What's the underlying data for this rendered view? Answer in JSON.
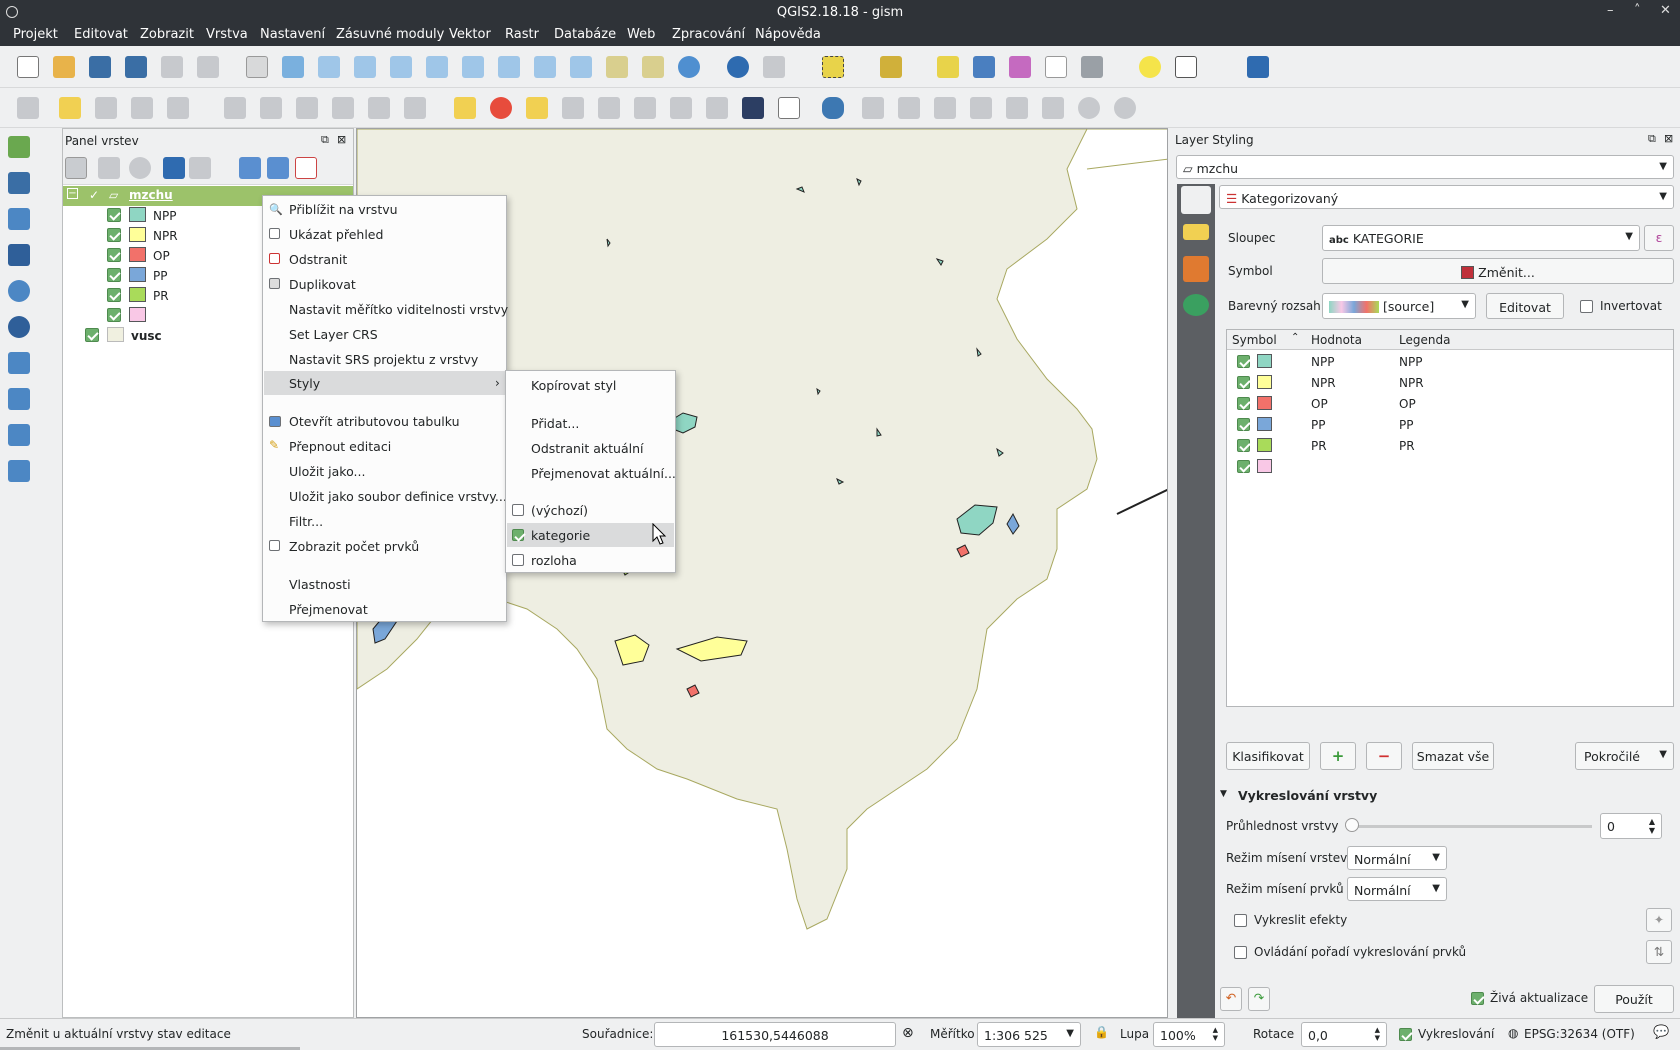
{
  "window": {
    "title": "QGIS2.18.18 - gism"
  },
  "menubar": [
    "Projekt",
    "Editovat",
    "Zobrazit",
    "Vrstva",
    "Nastavení",
    "Zásuvné moduly",
    "Vektor",
    "Rastr",
    "Databáze",
    "Web",
    "Zpracování",
    "Nápověda"
  ],
  "layers_panel": {
    "title": "Panel vrstev",
    "layer_main": "mzchu",
    "categories": [
      {
        "label": "NPP",
        "color": "#8fd6c3"
      },
      {
        "label": "NPR",
        "color": "#ffff99"
      },
      {
        "label": "OP",
        "color": "#f2716a"
      },
      {
        "label": "PP",
        "color": "#7aa7d9"
      },
      {
        "label": "PR",
        "color": "#a9db5a"
      },
      {
        "label": "",
        "color": "#f9c8e6"
      }
    ],
    "layer_second": "vusc"
  },
  "context_menu": {
    "items": [
      "Přiblížit na vrstvu",
      "Ukázat přehled",
      "Odstranit",
      "Duplikovat",
      "Nastavit měřítko viditelnosti vrstvy",
      "Set Layer CRS",
      "Nastavit SRS projektu z vrstvy",
      "Styly",
      "Otevřít atributovou tabulku",
      "Přepnout editaci",
      "Uložit jako...",
      "Uložit jako soubor definice vrstvy...",
      "Filtr...",
      "Zobrazit počet prvků",
      "Vlastnosti",
      "Přejmenovat"
    ]
  },
  "styles_submenu": {
    "items": [
      "Kopírovat styl",
      "Přidat...",
      "Odstranit aktuální",
      "Přejmenovat aktuální...",
      "(výchozí)",
      "kategorie",
      "rozloha"
    ],
    "checked": "kategorie"
  },
  "styling": {
    "title": "Layer Styling",
    "layer": "mzchu",
    "renderer": "Kategorizovaný",
    "column_label": "Sloupec",
    "column_type": "abc",
    "column": "KATEGORIE",
    "symbol_label": "Symbol",
    "symbol_btn": "Změnit...",
    "ramp_label": "Barevný rozsah",
    "ramp": "[source]",
    "edit_btn": "Editovat",
    "invert": "Invertovat",
    "table_headers": [
      "Symbol",
      "Hodnota",
      "Legenda"
    ],
    "rows": [
      {
        "value": "NPP",
        "legend": "NPP",
        "color": "#8fd6c3"
      },
      {
        "value": "NPR",
        "legend": "NPR",
        "color": "#ffff99"
      },
      {
        "value": "OP",
        "legend": "OP",
        "color": "#f2716a"
      },
      {
        "value": "PP",
        "legend": "PP",
        "color": "#7aa7d9"
      },
      {
        "value": "PR",
        "legend": "PR",
        "color": "#a9db5a"
      },
      {
        "value": "",
        "legend": "",
        "color": "#f9c8e6"
      }
    ],
    "classify_btn": "Klasifikovat",
    "delete_all_btn": "Smazat vše",
    "advanced_btn": "Pokročilé",
    "render_section": "Vykreslování vrstvy",
    "opacity_label": "Průhlednost vrstvy",
    "opacity": "0",
    "blend_layer_label": "Režim mísení vrstev",
    "blend_layer": "Normální",
    "blend_feature_label": "Režim mísení prvků",
    "blend_feature": "Normální",
    "effects_label": "Vykreslit efekty",
    "order_label": "Ovládání pořadí vykreslování prvků",
    "live_update": "Živá aktualizace",
    "apply_btn": "Použít"
  },
  "status": {
    "message": "Změnit u aktuální vrstvy stav editace",
    "coord_label": "Souřadnice:",
    "coord": "161530,5446088",
    "scale_label": "Měřítko",
    "scale": "1:306 525",
    "zoom_label": "Lupa",
    "zoom": "100%",
    "rotation_label": "Rotace",
    "rotation": "0,0",
    "render_label": "Vykreslování",
    "crs": "EPSG:32634 (OTF)"
  }
}
